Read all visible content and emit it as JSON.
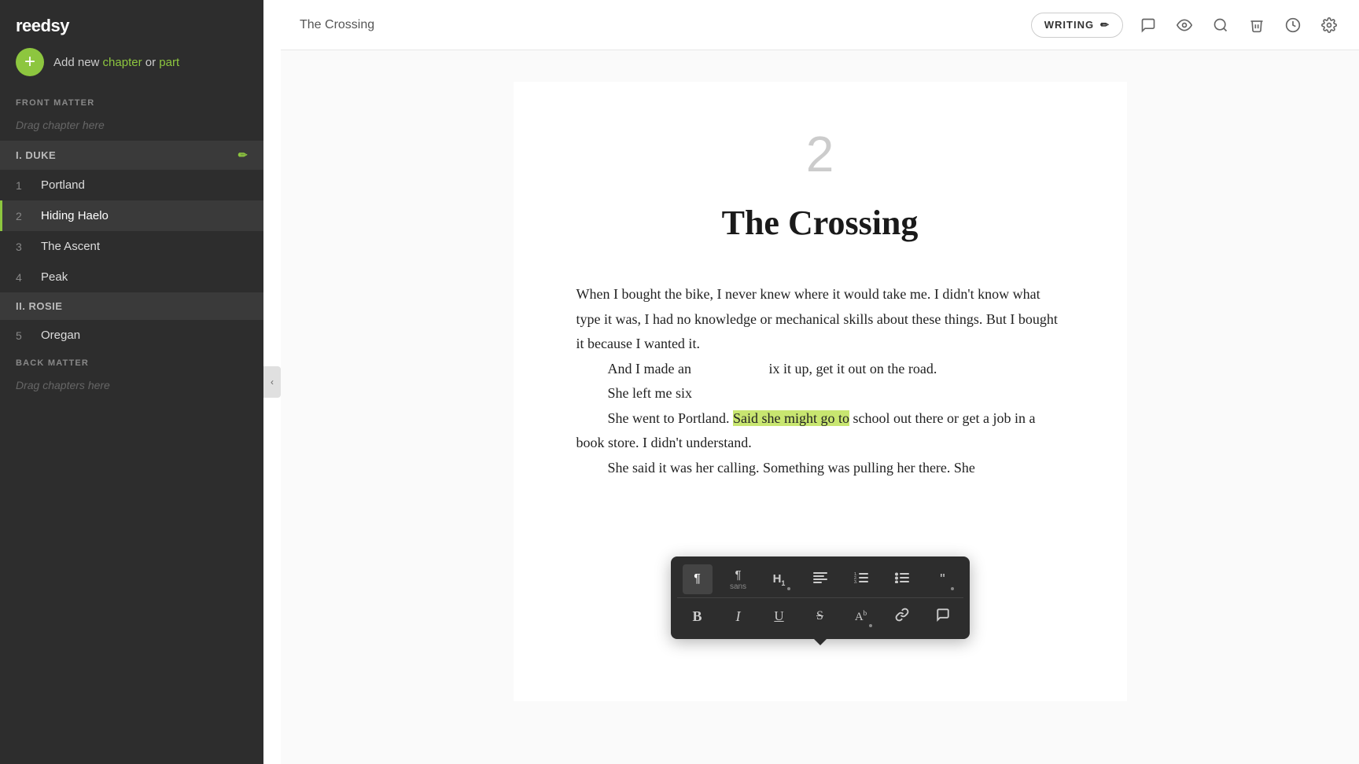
{
  "app": {
    "logo": "reedsy"
  },
  "sidebar": {
    "add_new_label": "Add new ",
    "add_new_chapter": "chapter",
    "add_new_or": " or ",
    "add_new_part": "part",
    "front_matter_label": "FRONT MATTER",
    "front_matter_placeholder": "Drag chapter here",
    "back_matter_label": "BACK MATTER",
    "back_matter_placeholder": "Drag chapters here",
    "parts": [
      {
        "id": "part-1",
        "label": "I. DUKE"
      },
      {
        "id": "part-2",
        "label": "II. ROSIE"
      }
    ],
    "chapters": [
      {
        "num": "1",
        "title": "Portland",
        "part": "part-1",
        "active": false
      },
      {
        "num": "2",
        "title": "Hiding Haelo",
        "part": "part-1",
        "active": true
      },
      {
        "num": "3",
        "title": "The Ascent",
        "part": "part-1",
        "active": false
      },
      {
        "num": "4",
        "title": "Peak",
        "part": "part-1",
        "active": false
      },
      {
        "num": "5",
        "title": "Oregan",
        "part": "part-2",
        "active": false
      }
    ]
  },
  "topbar": {
    "chapter_name": "The Crossing",
    "writing_mode_label": "WRITING",
    "writing_mode_icon": "✏",
    "comment_icon": "💬",
    "preview_icon": "👁",
    "search_icon": "🔍",
    "delete_icon": "🗑",
    "history_icon": "🕐",
    "settings_icon": "⚙"
  },
  "editor": {
    "chapter_number": "2",
    "chapter_title": "The Crossing",
    "paragraphs": [
      {
        "indent": false,
        "text": "When I bought the bike, I never knew where it would take me. I didn't know what type it was, I had no knowledge or mechanical skills about these things. But I bought it because I wanted it."
      },
      {
        "indent": true,
        "text": "And I made an",
        "suffix": "ix it up, get it out on the road."
      },
      {
        "indent": true,
        "text": "She left me six"
      },
      {
        "indent": true,
        "pre": "She went to Portland. ",
        "highlighted": "Said she might go to",
        "post": " school out there or get a job in a book store. I didn't understand."
      },
      {
        "indent": true,
        "text": "She said it was her calling. Something was pulling her there. She"
      }
    ]
  },
  "toolbar": {
    "row1": [
      {
        "id": "paragraph",
        "label": "¶",
        "title": "Paragraph"
      },
      {
        "id": "paragraph-sans",
        "label": "¶",
        "sublabel": "sans",
        "title": "Paragraph Sans"
      },
      {
        "id": "heading1",
        "label": "H₁",
        "title": "Heading 1",
        "has_badge": true
      },
      {
        "id": "align",
        "label": "≡",
        "title": "Align"
      },
      {
        "id": "ordered-list",
        "label": "⋮≡",
        "title": "Ordered List"
      },
      {
        "id": "unordered-list",
        "label": "⋮•",
        "title": "Unordered List"
      },
      {
        "id": "quote",
        "label": "❝",
        "title": "Quote",
        "has_badge": true
      }
    ],
    "row2": [
      {
        "id": "bold",
        "label": "B",
        "title": "Bold",
        "style": "bold"
      },
      {
        "id": "italic",
        "label": "I",
        "title": "Italic",
        "style": "italic"
      },
      {
        "id": "underline",
        "label": "U",
        "title": "Underline",
        "style": "underline"
      },
      {
        "id": "strikethrough",
        "label": "S",
        "title": "Strikethrough",
        "style": "strike"
      },
      {
        "id": "superscript",
        "label": "Aᵇ",
        "title": "Superscript",
        "has_badge": true
      },
      {
        "id": "link",
        "label": "🔗",
        "title": "Link"
      },
      {
        "id": "comment",
        "label": "💬",
        "title": "Comment"
      }
    ]
  }
}
